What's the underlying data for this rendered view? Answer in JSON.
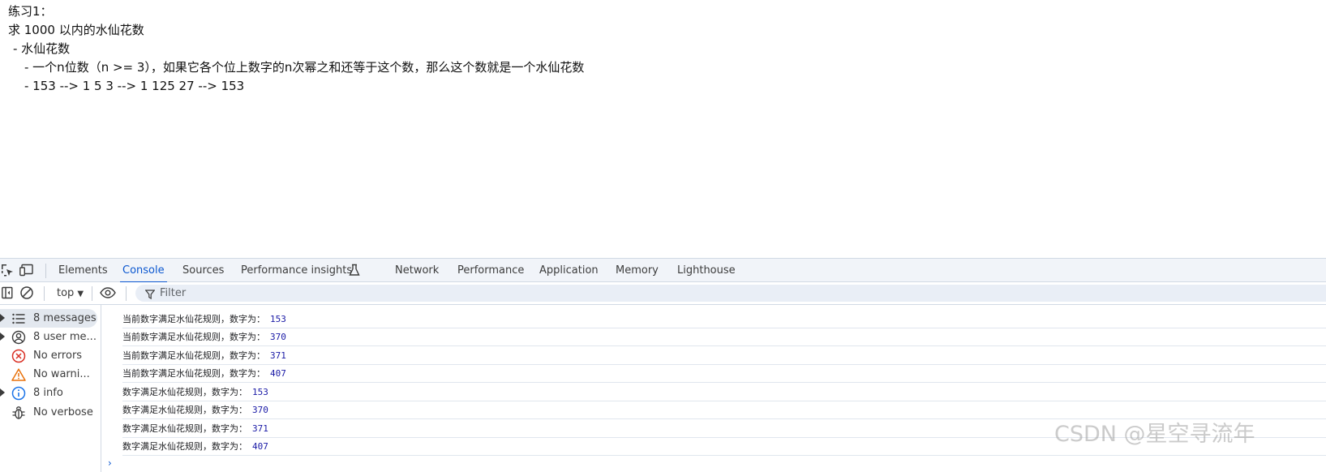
{
  "page": {
    "lines": [
      "练习1：",
      "求 1000 以内的水仙花数",
      "- 水仙花数",
      "- 一个n位数（n >= 3），如果它各个位上数字的n次幂之和还等于这个数，那么这个数就是一个水仙花数",
      "- 153 --> 1  5  3 --> 1  125  27 --> 153"
    ]
  },
  "devtools": {
    "tabs": [
      "Elements",
      "Console",
      "Sources",
      "Performance insights",
      "Network",
      "Performance",
      "Application",
      "Memory",
      "Lighthouse"
    ],
    "active_tab": "Console",
    "toolbar": {
      "context": "top",
      "filter_placeholder": "Filter"
    },
    "sidebar": [
      {
        "label": "8 messages",
        "icon": "list-icon",
        "expandable": true,
        "selected": true
      },
      {
        "label": "8 user me...",
        "icon": "user-icon",
        "expandable": true,
        "selected": false
      },
      {
        "label": "No errors",
        "icon": "error-icon",
        "expandable": false,
        "selected": false
      },
      {
        "label": "No warni...",
        "icon": "warning-icon",
        "expandable": false,
        "selected": false
      },
      {
        "label": "8 info",
        "icon": "info-icon",
        "expandable": true,
        "selected": false
      },
      {
        "label": "No verbose",
        "icon": "bug-icon",
        "expandable": false,
        "selected": false
      }
    ],
    "messages": [
      {
        "text": "当前数字满足水仙花规则，数字为：",
        "value": "153"
      },
      {
        "text": "当前数字满足水仙花规则，数字为：",
        "value": "370"
      },
      {
        "text": "当前数字满足水仙花规则，数字为：",
        "value": "371"
      },
      {
        "text": "当前数字满足水仙花规则，数字为：",
        "value": "407"
      },
      {
        "text": "数字满足水仙花规则，数字为：",
        "value": "153"
      },
      {
        "text": "数字满足水仙花规则，数字为：",
        "value": "370"
      },
      {
        "text": "数字满足水仙花规则，数字为：",
        "value": "371"
      },
      {
        "text": "数字满足水仙花规则，数字为：",
        "value": "407"
      }
    ],
    "prompt": "›"
  },
  "watermark": "CSDN @星空寻流年",
  "colors": {
    "accent": "#0b57d0",
    "error": "#d93025",
    "warning": "#e8710a",
    "info": "#1a73e8",
    "number": "#1a1aa6"
  }
}
